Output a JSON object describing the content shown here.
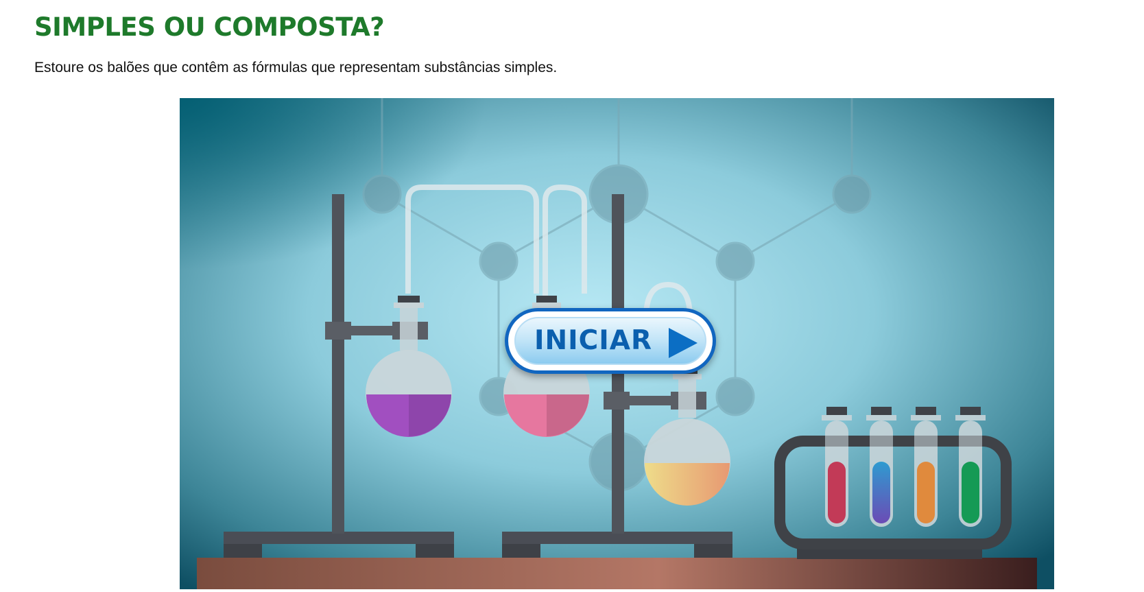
{
  "page": {
    "title": "SIMPLES OU COMPOSTA?",
    "instructions": "Estoure os balões que contêm as fórmulas que representam substâncias simples."
  },
  "game": {
    "start_button_label": "INICIAR",
    "start_button_icon": "play-triangle-icon",
    "scene_icons": [
      "laboratory-scene",
      "retort-stand-icon",
      "round-flask-icon",
      "test-tube-rack-icon",
      "molecule-network-icon"
    ]
  },
  "colors": {
    "title": "#1e7a2b",
    "button_border": "#1166c0",
    "button_text": "#0b5fae",
    "flask_purple": "#a14fc0",
    "flask_pink": "#e6779f",
    "flask_orange": "#eba86c",
    "tube_red": "#c23a57",
    "tube_blue": "#4d6fc3",
    "tube_orange": "#e08a3d",
    "tube_green": "#159a55",
    "table": "#9a5d4d"
  }
}
